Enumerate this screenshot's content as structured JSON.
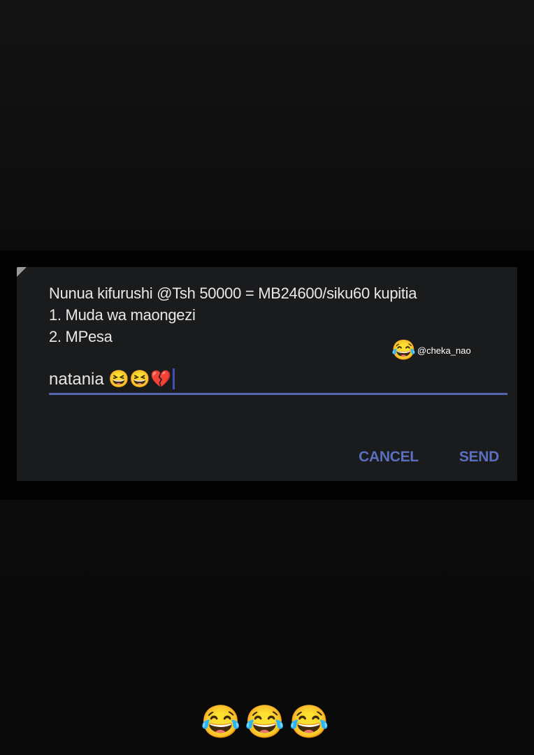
{
  "dialog": {
    "message_lines": [
      "Nunua kifurushi @Tsh 50000 = MB24600/siku60 kupitia",
      "1. Muda wa maongezi",
      "2. MPesa"
    ],
    "input_value": "natania 😆😆💔",
    "cancel_label": "CANCEL",
    "send_label": "SEND"
  },
  "watermark": {
    "emoji": "😂",
    "handle": "@cheka_nao"
  },
  "caption": {
    "emojis": "😂😂😂"
  },
  "colors": {
    "accent": "#5c6fbf",
    "dialog_bg": "#1a1b1d",
    "page_bg": "#0a0a0a"
  }
}
